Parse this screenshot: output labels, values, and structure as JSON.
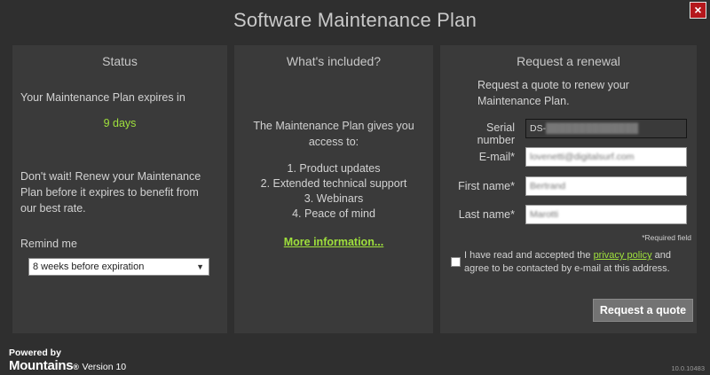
{
  "window": {
    "title": "Software Maintenance Plan",
    "close_glyph": "×"
  },
  "status": {
    "title": "Status",
    "expires_text": "Your Maintenance Plan expires in",
    "days": "9 days",
    "renew_lines": [
      "Don't wait! Renew your Maintenance",
      "Plan before it expires to benefit from",
      "our best rate."
    ],
    "remind_label": "Remind me",
    "remind_selected": "8 weeks before expiration"
  },
  "included": {
    "title": "What's included?",
    "intro_lines": [
      "The Maintenance Plan gives you",
      "access to:"
    ],
    "items": [
      "1. Product updates",
      "2. Extended technical support",
      "3. Webinars",
      "4. Peace of mind"
    ],
    "more_link": "More information..."
  },
  "renewal": {
    "title": "Request a renewal",
    "intro_lines": [
      "Request a quote to renew your",
      "Maintenance Plan."
    ],
    "serial_label": "Serial number",
    "serial_value": "DS-",
    "email_label": "E-mail*",
    "email_value": "lovenetti@digitalsurf.com",
    "first_label": "First name*",
    "first_value": "Bertrand",
    "last_label": "Last name*",
    "last_value": "Marotti",
    "required_note": "*Required field",
    "agree_pre": "I have read and accepted the",
    "agree_link": "privacy policy",
    "agree_post": "and agree to be contacted by e-mail at this address.",
    "button": "Request a quote"
  },
  "footer": {
    "powered": "Powered by",
    "brand": "Mountains",
    "version": "Version 10",
    "build": "10.0.10483"
  }
}
